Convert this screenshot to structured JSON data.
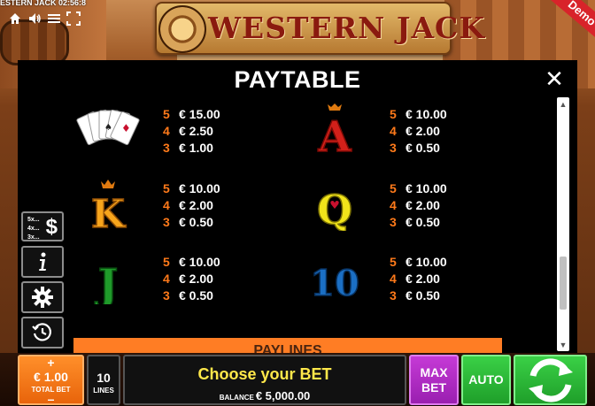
{
  "header": {
    "game_clock": "ESTERN JACK 02:56:8",
    "logo_text": "WESTERN JACK",
    "demo_ribbon": "Demo"
  },
  "top_icons": [
    "home-icon",
    "volume-icon",
    "menu-icon",
    "fullscreen-icon"
  ],
  "paytable": {
    "title": "PAYTABLE",
    "close_label": "✕",
    "rows": [
      {
        "symbol": "playing-cards",
        "pays": [
          {
            "count": "5",
            "amount": "€ 15.00"
          },
          {
            "count": "4",
            "amount": "€ 2.50"
          },
          {
            "count": "3",
            "amount": "€ 1.00"
          }
        ]
      },
      {
        "symbol": "A",
        "pays": [
          {
            "count": "5",
            "amount": "€ 10.00"
          },
          {
            "count": "4",
            "amount": "€ 2.00"
          },
          {
            "count": "3",
            "amount": "€ 0.50"
          }
        ]
      },
      {
        "symbol": "K",
        "pays": [
          {
            "count": "5",
            "amount": "€ 10.00"
          },
          {
            "count": "4",
            "amount": "€ 2.00"
          },
          {
            "count": "3",
            "amount": "€ 0.50"
          }
        ]
      },
      {
        "symbol": "Q",
        "pays": [
          {
            "count": "5",
            "amount": "€ 10.00"
          },
          {
            "count": "4",
            "amount": "€ 2.00"
          },
          {
            "count": "3",
            "amount": "€ 0.50"
          }
        ]
      },
      {
        "symbol": "J",
        "pays": [
          {
            "count": "5",
            "amount": "€ 10.00"
          },
          {
            "count": "4",
            "amount": "€ 2.00"
          },
          {
            "count": "3",
            "amount": "€ 0.50"
          }
        ]
      },
      {
        "symbol": "10",
        "pays": [
          {
            "count": "5",
            "amount": "€ 10.00"
          },
          {
            "count": "4",
            "amount": "€ 2.00"
          },
          {
            "count": "3",
            "amount": "€ 0.50"
          }
        ]
      }
    ],
    "next_section": "PAYLINES"
  },
  "side_buttons": {
    "paytable_multipliers": [
      "5x...",
      "4x...",
      "3x..."
    ],
    "paytable_symbol": "$"
  },
  "bottom": {
    "bet_plus": "+",
    "bet_value": "€ 1.00",
    "bet_label": "TOTAL BET",
    "bet_minus": "–",
    "lines_value": "10",
    "lines_label": "LINES",
    "message": "Choose your BET",
    "balance_label": "BALANCE",
    "balance_value": "€ 5,000.00",
    "maxbet_line1": "MAX",
    "maxbet_line2": "BET",
    "auto_label": "AUTO"
  },
  "colors": {
    "count": "#ff7a1a",
    "bet_box": "#ff8f2a",
    "message": "#ffe84a",
    "maxbet": "#c53ad6",
    "spin": "#3ad046"
  }
}
